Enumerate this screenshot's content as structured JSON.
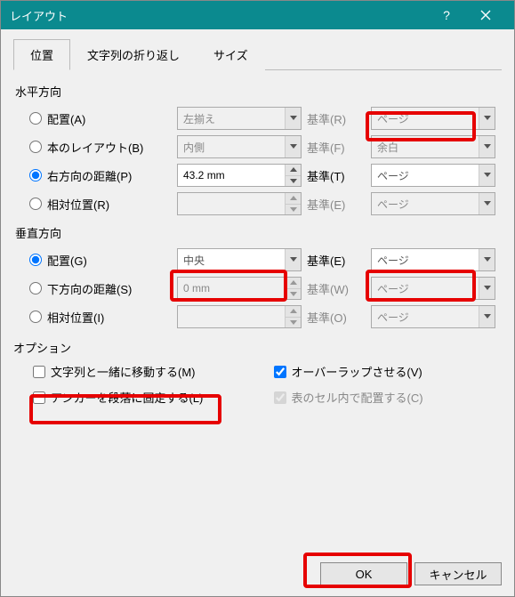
{
  "title": "レイアウト",
  "tabs": [
    "位置",
    "文字列の折り返し",
    "サイズ"
  ],
  "horizontal": {
    "label": "水平方向",
    "rows": [
      {
        "radio": "配置(A)",
        "val": "左揃え",
        "base": "基準(R)",
        "baseVal": "ページ",
        "disabled": true
      },
      {
        "radio": "本のレイアウト(B)",
        "val": "内側",
        "base": "基準(F)",
        "baseVal": "余白",
        "disabled": true
      },
      {
        "radio": "右方向の距離(P)",
        "val": "43.2 mm",
        "base": "基準(T)",
        "baseVal": "ページ",
        "spinner": true,
        "checked": true
      },
      {
        "radio": "相対位置(R)",
        "val": "",
        "base": "基準(E)",
        "baseVal": "ページ",
        "spinner": true,
        "disabled": true
      }
    ]
  },
  "vertical": {
    "label": "垂直方向",
    "rows": [
      {
        "radio": "配置(G)",
        "val": "中央",
        "base": "基準(E)",
        "baseVal": "ページ",
        "checked": true
      },
      {
        "radio": "下方向の距離(S)",
        "val": "0 mm",
        "base": "基準(W)",
        "baseVal": "ページ",
        "spinner": true,
        "disabled": true
      },
      {
        "radio": "相対位置(I)",
        "val": "",
        "base": "基準(O)",
        "baseVal": "ページ",
        "spinner": true,
        "disabled": true
      }
    ]
  },
  "options": {
    "legend": "オプション",
    "moveWithText": "文字列と一緒に移動する(M)",
    "overlap": "オーバーラップさせる(V)",
    "lockAnchor": "アンカーを段落に固定する(L)",
    "layoutInCell": "表のセル内で配置する(C)"
  },
  "buttons": {
    "ok": "OK",
    "cancel": "キャンセル"
  }
}
